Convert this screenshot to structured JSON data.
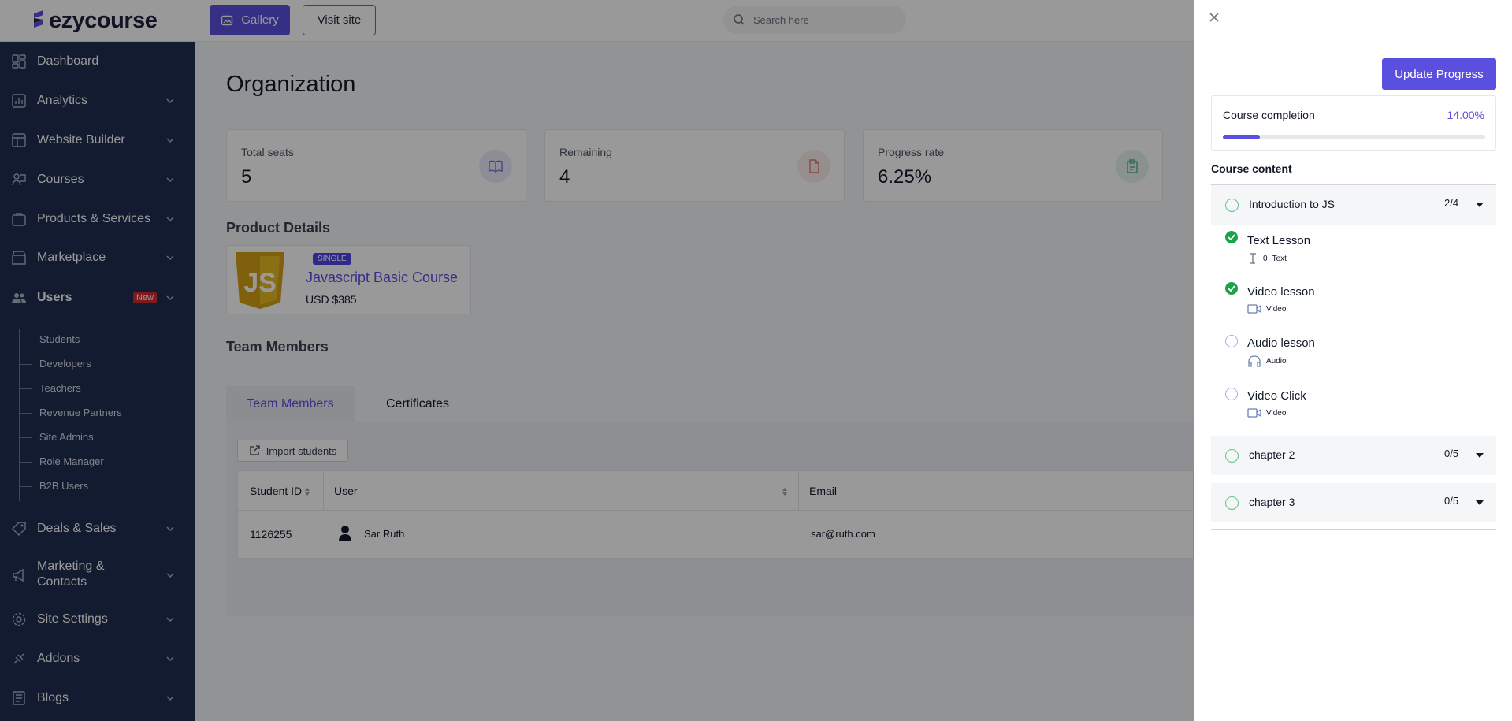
{
  "brand": {
    "name": "ezycourse"
  },
  "topbar": {
    "gallery_label": "Gallery",
    "visit_label": "Visit site",
    "search_placeholder": "Search here"
  },
  "sidebar": {
    "items": [
      {
        "label": "Dashboard",
        "icon": "dashboard-icon"
      },
      {
        "label": "Analytics",
        "icon": "analytics-icon"
      },
      {
        "label": "Website Builder",
        "icon": "website-builder-icon"
      },
      {
        "label": "Courses",
        "icon": "courses-icon"
      },
      {
        "label": "Products & Services",
        "icon": "products-icon"
      },
      {
        "label": "Marketplace",
        "icon": "marketplace-icon"
      },
      {
        "label": "Users",
        "icon": "users-icon",
        "badge": "New"
      },
      {
        "label": "Deals & Sales",
        "icon": "deals-icon"
      },
      {
        "label": "Marketing &",
        "label2": "Contacts",
        "icon": "marketing-icon"
      },
      {
        "label": "Site Settings",
        "icon": "settings-icon"
      },
      {
        "label": "Addons",
        "icon": "addons-icon"
      },
      {
        "label": "Blogs",
        "icon": "blogs-icon"
      }
    ],
    "users_sub": [
      "Students",
      "Developers",
      "Teachers",
      "Revenue Partners",
      "Site Admins",
      "Role Manager",
      "B2B Users"
    ]
  },
  "main": {
    "title": "Organization",
    "stats": [
      {
        "label": "Total seats",
        "value": "5",
        "icon": "book-icon",
        "color": "#7b6fe0"
      },
      {
        "label": "Remaining",
        "value": "4",
        "icon": "document-icon",
        "color": "#e07b7b"
      },
      {
        "label": "Progress rate",
        "value": "6.25%",
        "icon": "clipboard-icon",
        "color": "#5bb08a"
      }
    ],
    "product_section": "Product Details",
    "product": {
      "badge": "SINGLE",
      "name": "Javascript Basic Course",
      "price": "USD $385"
    },
    "team_section": "Team Members",
    "tabs": [
      "Team Members",
      "Certificates"
    ],
    "import_label": "Import students",
    "table": {
      "headers": [
        "Student ID",
        "User",
        "Email"
      ],
      "rows": [
        {
          "id": "1126255",
          "user": "Sar Ruth",
          "email": "sar@ruth.com"
        }
      ]
    }
  },
  "drawer": {
    "update_label": "Update Progress",
    "completion_label": "Course completion",
    "completion_value": "14.00%",
    "completion_fraction": 0.14,
    "content_title": "Course content",
    "chapters": [
      {
        "title": "Introduction to JS",
        "count": "2/4"
      },
      {
        "title": "chapter 2",
        "count": "0/5"
      },
      {
        "title": "chapter 3",
        "count": "0/5"
      }
    ],
    "lessons": [
      {
        "title": "Text Lesson",
        "type": "Text",
        "prefix": "0",
        "done": true,
        "icon": "text-icon"
      },
      {
        "title": "Video lesson",
        "type": "Video",
        "done": true,
        "icon": "video-icon"
      },
      {
        "title": "Audio lesson",
        "type": "Audio",
        "done": false,
        "icon": "headphones-icon"
      },
      {
        "title": "Video Click",
        "type": "Video",
        "done": false,
        "icon": "video-icon"
      }
    ]
  }
}
